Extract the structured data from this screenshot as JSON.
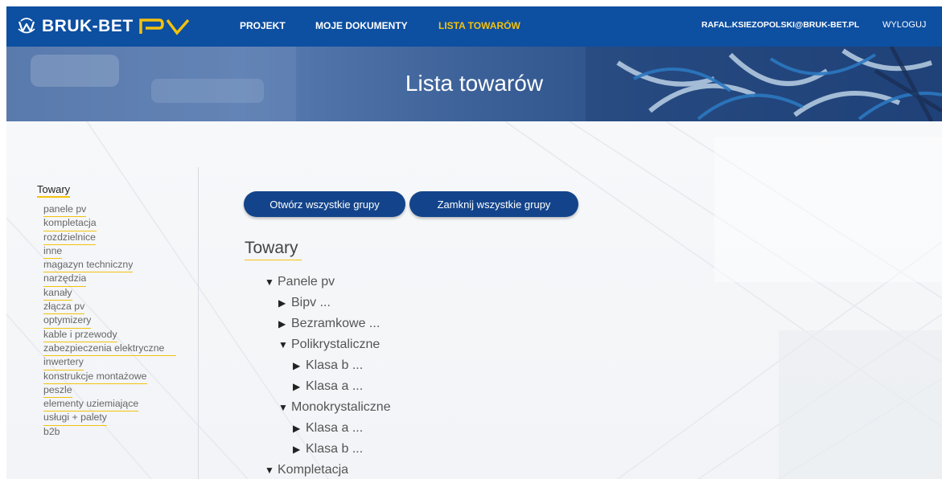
{
  "navbar": {
    "logo_text": "BRUK-BET",
    "logo_suffix": "PV",
    "items": [
      "PROJEKT",
      "MOJE DOKUMENTY",
      "LISTA TOWARÓW"
    ],
    "user_email": "RAFAL.KSIEZOPOLSKI@BRUK-BET.PL",
    "logout": "WYLOGUJ"
  },
  "hero": {
    "title": "Lista towarów"
  },
  "sidebar": {
    "title": "Towary",
    "items": [
      "panele pv",
      "kompletacja",
      "rozdzielnice",
      "inne",
      "magazyn techniczny",
      "narzędzia",
      "kanały",
      "złącza pv",
      "optymizery",
      "kable i przewody",
      "zabezpieczenia elektryczne",
      "inwertery",
      "konstrukcje montażowe",
      "peszle",
      "elementy uziemiające",
      "usługi + palety",
      "b2b"
    ]
  },
  "buttons": {
    "open_all": "Otwórz wszystkie grupy",
    "close_all": "Zamknij wszystkie grupy"
  },
  "tree": {
    "title": "Towary",
    "nodes": [
      {
        "label": "Panele pv",
        "state": "expanded"
      },
      {
        "label": "Bipv ...",
        "state": "collapsed"
      },
      {
        "label": "Bezramkowe ...",
        "state": "collapsed"
      },
      {
        "label": "Polikrystaliczne",
        "state": "expanded"
      },
      {
        "label": "Klasa b ...",
        "state": "collapsed"
      },
      {
        "label": "Klasa a ...",
        "state": "collapsed"
      },
      {
        "label": "Monokrystaliczne",
        "state": "expanded"
      },
      {
        "label": "Klasa a ...",
        "state": "collapsed"
      },
      {
        "label": "Klasa b ...",
        "state": "collapsed"
      },
      {
        "label": "Kompletacja",
        "state": "expanded"
      }
    ],
    "caret_expanded": "▼",
    "caret_collapsed": "▶"
  },
  "colors": {
    "navbar_bg": "#0d4fa1",
    "accent": "#f3c20f",
    "button_bg": "#13448b"
  }
}
